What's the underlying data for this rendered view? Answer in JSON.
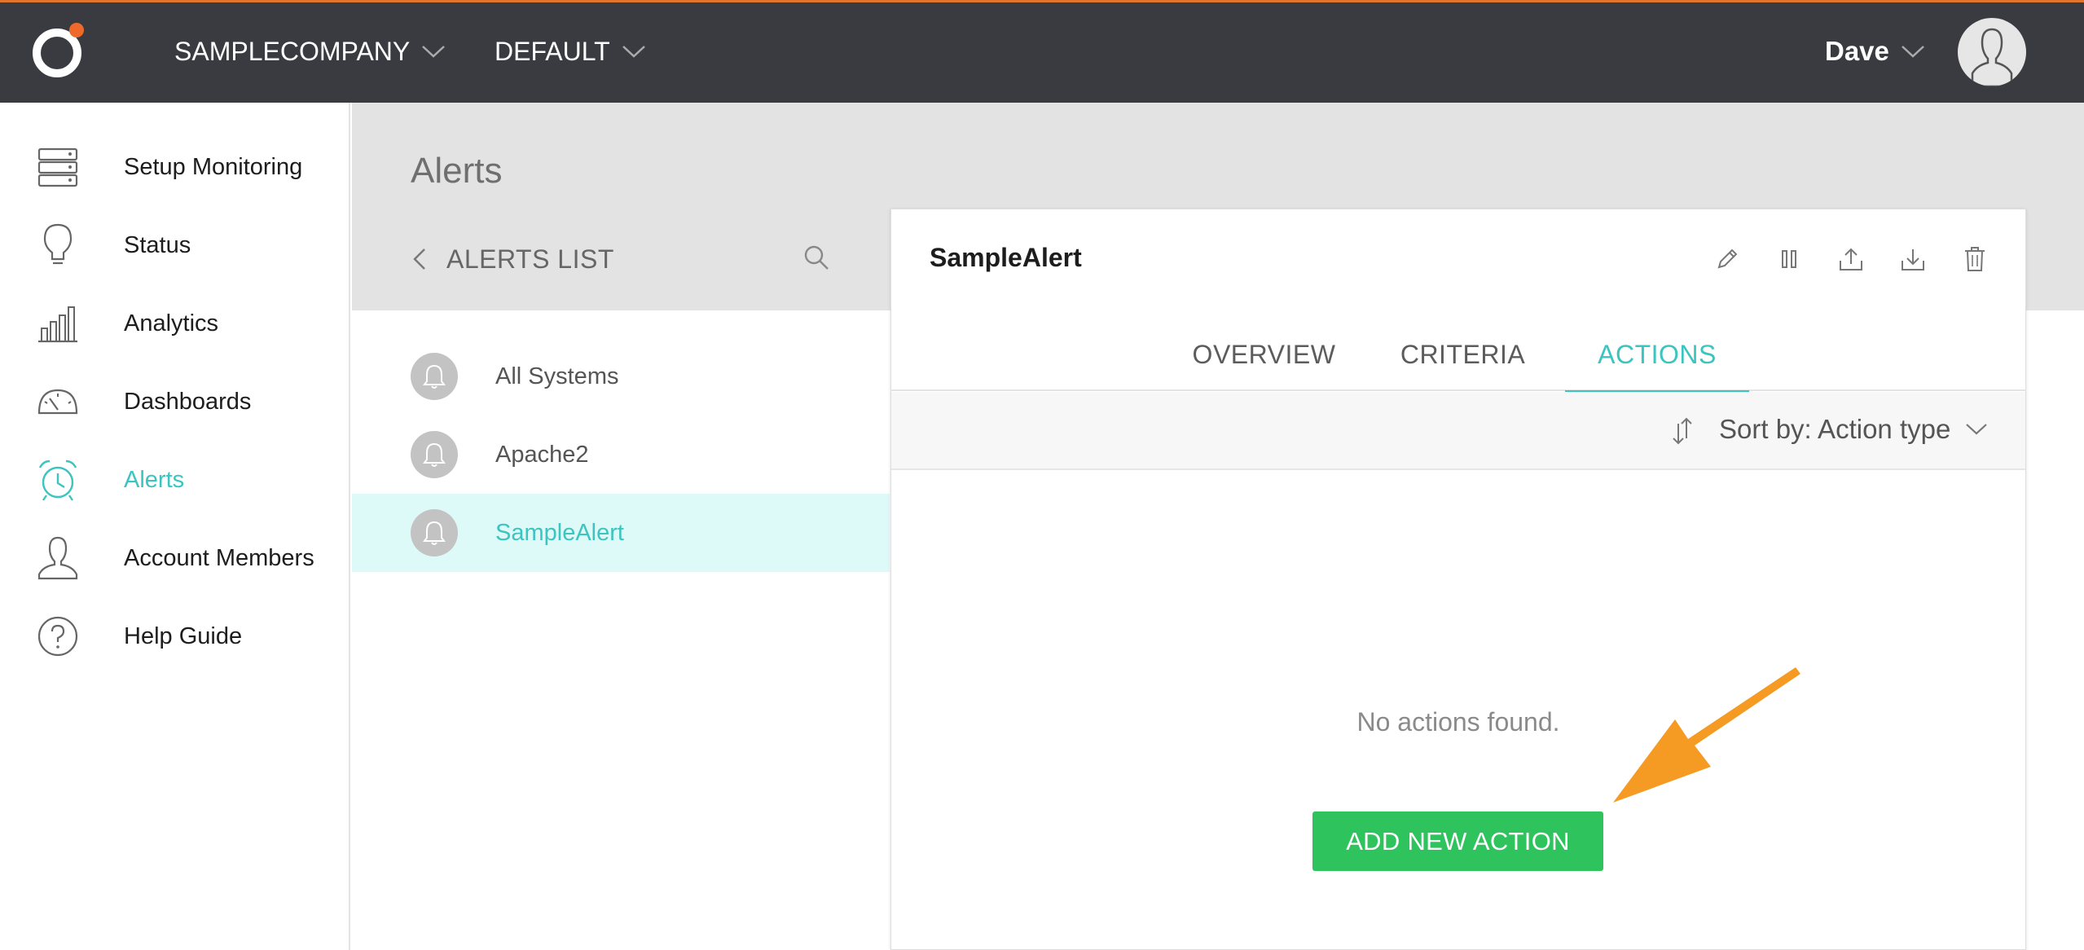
{
  "topbar": {
    "company_label": "SAMPLECOMPANY",
    "environment_label": "DEFAULT",
    "user_name": "Dave",
    "accent_color": "#e0752b",
    "bg_color": "#3a3b40"
  },
  "sidebar": {
    "items": [
      {
        "label": "Setup Monitoring",
        "icon": "server-icon"
      },
      {
        "label": "Status",
        "icon": "lightbulb-icon"
      },
      {
        "label": "Analytics",
        "icon": "bar-chart-icon"
      },
      {
        "label": "Dashboards",
        "icon": "gauge-icon"
      },
      {
        "label": "Alerts",
        "icon": "alarm-clock-icon",
        "active": true
      },
      {
        "label": "Account Members",
        "icon": "user-icon"
      },
      {
        "label": "Help Guide",
        "icon": "help-circle-icon"
      }
    ],
    "active_color": "#3cc4c0"
  },
  "page": {
    "title": "Alerts"
  },
  "alerts_list": {
    "back_label": "ALERTS LIST",
    "items": [
      {
        "label": "All Systems"
      },
      {
        "label": "Apache2"
      },
      {
        "label": "SampleAlert",
        "selected": true
      }
    ]
  },
  "detail": {
    "title": "SampleAlert",
    "tools": [
      "edit-icon",
      "pause-icon",
      "upload-icon",
      "download-icon",
      "trash-icon"
    ],
    "tabs": [
      {
        "label": "OVERVIEW"
      },
      {
        "label": "CRITERIA"
      },
      {
        "label": "ACTIONS",
        "active": true
      }
    ],
    "sort_label": "Sort by: Action type",
    "empty_message": "No actions found.",
    "add_button_label": "ADD NEW ACTION",
    "add_button_color": "#2fc35e",
    "annotation_arrow_color": "#f59a23"
  }
}
